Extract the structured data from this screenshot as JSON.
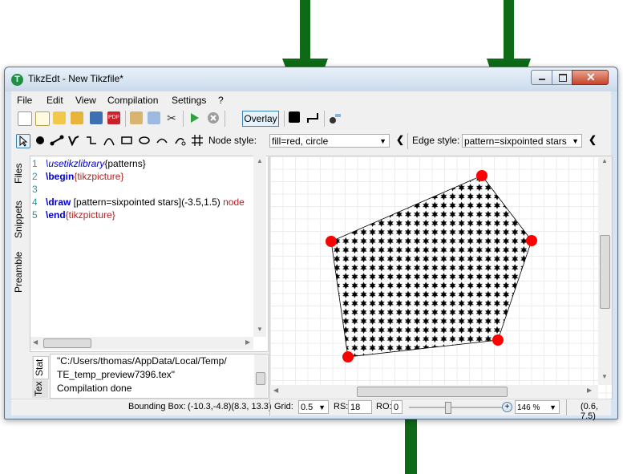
{
  "window": {
    "title": "TikzEdt - New Tikzfile*",
    "app_icon": "T"
  },
  "menu": [
    "File",
    "Edit",
    "View",
    "Compilation",
    "Settings",
    "?"
  ],
  "toolbar": {
    "overlay_label": "Overlay"
  },
  "drawbar": {
    "node_style_label": "Node style:",
    "node_style_value": "fill=red, circle",
    "edge_style_label": "Edge style:",
    "edge_style_value": "pattern=sixpointed stars"
  },
  "side_tabs": [
    "Files",
    "Snippets",
    "Preamble"
  ],
  "editor": {
    "lines": [
      {
        "num": "1",
        "cmd": "\\usetikzlibrary",
        "arg": "{patterns}",
        "rest": ""
      },
      {
        "num": "2",
        "cmd": "\\begin",
        "arg": "{tikzpicture}",
        "rest": ""
      },
      {
        "num": "3",
        "cmd": "",
        "arg": "",
        "rest": ""
      },
      {
        "num": "4",
        "cmd": "\\draw",
        "arg": "",
        "rest": " [pattern=sixpointed stars](-3.5,1.5) node"
      },
      {
        "num": "5",
        "cmd": "\\end",
        "arg": "{tikzpicture}",
        "rest": ""
      }
    ]
  },
  "log": {
    "tabs": [
      "Stat",
      "Tex"
    ],
    "lines": [
      "\"C:/Users/thomas/AppData/Local/Temp/",
      "TE_temp_preview7396.tex\"",
      "Compilation done"
    ]
  },
  "status": {
    "bbox_label": "Bounding Box:",
    "bbox_value": "(-10.3,-4.8)(8.3, 13.3)",
    "grid_label": "Grid:",
    "grid_value": "0.5",
    "rs_label": "RS:",
    "rs_value": "18",
    "ro_label": "RO:",
    "ro_value": "0",
    "zoom_value": "146 %",
    "coords": "(0.6, 7.5)"
  },
  "colors": {
    "arrow": "#0e6a17",
    "node": "#ff0000",
    "pattern": "#000000"
  }
}
